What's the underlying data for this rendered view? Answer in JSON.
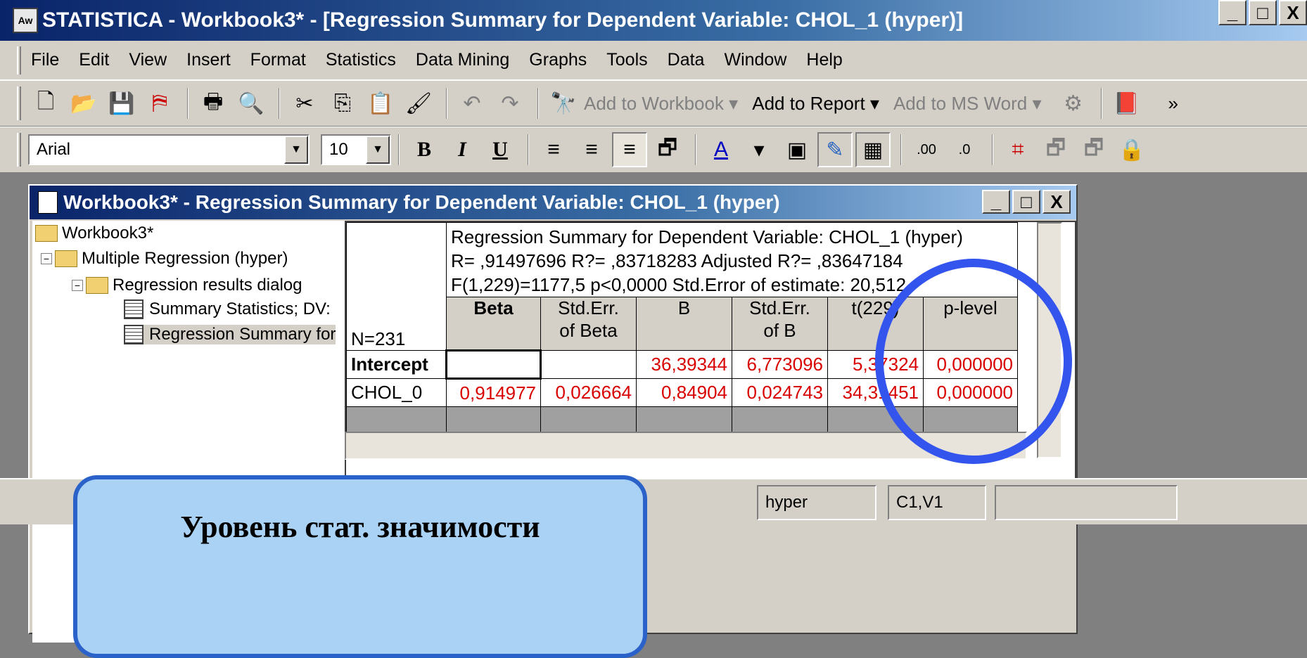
{
  "app": {
    "title": "STATISTICA - Workbook3* - [Regression Summary for Dependent Variable: CHOL_1 (hyper)]",
    "icon": "statistica-icon"
  },
  "window_buttons": {
    "minimize": "_",
    "maximize": "□",
    "close": "X"
  },
  "menu": [
    "File",
    "Edit",
    "View",
    "Insert",
    "Format",
    "Statistics",
    "Data Mining",
    "Graphs",
    "Tools",
    "Data",
    "Window",
    "Help"
  ],
  "toolbar1": {
    "add_workbook": "Add to Workbook ▾",
    "add_report": "Add to Report ▾",
    "add_word": "Add to MS Word ▾",
    "more": "»"
  },
  "toolbar2": {
    "font": "Arial",
    "size": "10",
    "bold": "B",
    "italic": "I",
    "underline": "U"
  },
  "workbook": {
    "title": "Workbook3* - Regression Summary for Dependent Variable: CHOL_1 (hyper)",
    "tree": [
      "Workbook3*",
      "Multiple Regression (hyper)",
      "Regression results dialog",
      "Summary Statistics; DV:",
      "Regression Summary for"
    ]
  },
  "sheet": {
    "header_line1": "Regression Summary for Dependent Variable: CHOL_1 (hyper)",
    "header_line2": "R= ,91497696 R?= ,83718283 Adjusted R?= ,83647184",
    "header_line3": "F(1,229)=1177,5 p<0,0000 Std.Error of estimate: 20,512",
    "n_label": "N=231",
    "columns": [
      [
        "Beta",
        ""
      ],
      [
        "Std.Err.",
        "of Beta"
      ],
      [
        "B",
        ""
      ],
      [
        "Std.Err.",
        "of B"
      ],
      [
        "t(229)",
        ""
      ],
      [
        "p-level",
        ""
      ]
    ],
    "rows": [
      {
        "label": "Intercept",
        "values": [
          "",
          "",
          "36,39344",
          "6,773096",
          "5,37324",
          "0,000000"
        ]
      },
      {
        "label": "CHOL_0",
        "values": [
          "0,914977",
          "0,026664",
          "0,84904",
          "0,024743",
          "34,31451",
          "0,000000"
        ]
      }
    ]
  },
  "statusbar": {
    "cell1": "hyper",
    "cell2": "C1,V1"
  },
  "callout": {
    "text": "Уровень стат. значимости"
  }
}
